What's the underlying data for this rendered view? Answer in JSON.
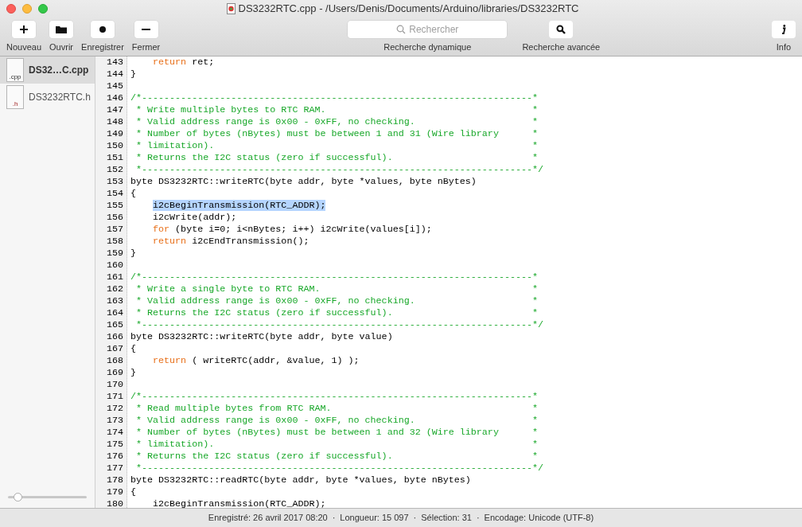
{
  "window": {
    "title": "DS3232RTC.cpp - /Users/Denis/Documents/Arduino/libraries/DS3232RTC"
  },
  "toolbar": {
    "left_buttons": [
      {
        "kind": "plus",
        "label": "Nouveau"
      },
      {
        "kind": "folder",
        "label": "Ouvrir"
      },
      {
        "kind": "dot",
        "label": "Enregistrer"
      },
      {
        "kind": "minus",
        "label": "Fermer"
      }
    ],
    "search": {
      "placeholder": "Rechercher",
      "label": "Recherche dynamique"
    },
    "advanced_search": {
      "label": "Recherche avancée"
    },
    "info": {
      "label": "Info"
    }
  },
  "sidebar": {
    "items": [
      {
        "kind": "cpp",
        "name": "DS32…C.cpp",
        "badge": ".cpp",
        "selected": true
      },
      {
        "kind": "h",
        "name": "DS3232RTC.h",
        "badge": ".h",
        "selected": false
      }
    ],
    "zoom_slider": {
      "level": 0.08
    }
  },
  "editor": {
    "lines": [
      {
        "number": "143",
        "indent": true,
        "segments": [
          {
            "kind": "keyword",
            "text": "return"
          },
          {
            "kind": "code",
            "text": " ret;"
          }
        ]
      },
      {
        "number": "144",
        "segments": [
          {
            "kind": "code",
            "text": "}"
          }
        ]
      },
      {
        "number": "145"
      },
      {
        "number": "146",
        "segments": [
          {
            "kind": "comment",
            "text": "/*----------------------------------------------------------------------"
          },
          {
            "kind": "star",
            "text": "*"
          }
        ]
      },
      {
        "number": "147",
        "segments": [
          {
            "kind": "comment",
            "text": " * Write multiple bytes to RTC RAM."
          },
          {
            "kind": "star",
            "text": "*"
          }
        ]
      },
      {
        "number": "148",
        "segments": [
          {
            "kind": "comment",
            "text": " * Valid address range is 0x00 - 0xFF, no checking."
          },
          {
            "kind": "star",
            "text": "*"
          }
        ]
      },
      {
        "number": "149",
        "segments": [
          {
            "kind": "comment",
            "text": " * Number of bytes (nBytes) must be between 1 and 31 (Wire library"
          },
          {
            "kind": "star",
            "text": "*"
          }
        ]
      },
      {
        "number": "150",
        "segments": [
          {
            "kind": "comment",
            "text": " * limitation)."
          },
          {
            "kind": "star",
            "text": "*"
          }
        ]
      },
      {
        "number": "151",
        "segments": [
          {
            "kind": "comment",
            "text": " * Returns the I2C status (zero if successful)."
          },
          {
            "kind": "star",
            "text": "*"
          }
        ]
      },
      {
        "number": "152",
        "segments": [
          {
            "kind": "comment",
            "text": " *----------------------------------------------------------------------*/"
          }
        ]
      },
      {
        "number": "153",
        "segments": [
          {
            "kind": "code",
            "text": "byte DS3232RTC::writeRTC(byte addr, byte *values, byte nBytes)"
          }
        ]
      },
      {
        "number": "154",
        "segments": [
          {
            "kind": "code",
            "text": "{"
          }
        ]
      },
      {
        "number": "155",
        "indent": true,
        "segments": [
          {
            "kind": "selected",
            "text": "i2cBeginTransmission(RTC_ADDR);"
          }
        ]
      },
      {
        "number": "156",
        "segments": [
          {
            "kind": "code",
            "text": "    i2cWrite(addr);"
          }
        ]
      },
      {
        "number": "157",
        "indent": true,
        "segments": [
          {
            "kind": "keyword",
            "text": "for"
          },
          {
            "kind": "code",
            "text": " (byte i=0; i<nBytes; i++) i2cWrite(values[i]);"
          }
        ]
      },
      {
        "number": "158",
        "indent": true,
        "segments": [
          {
            "kind": "keyword",
            "text": "return"
          },
          {
            "kind": "code",
            "text": " i2cEndTransmission();"
          }
        ]
      },
      {
        "number": "159",
        "segments": [
          {
            "kind": "code",
            "text": "}"
          }
        ]
      },
      {
        "number": "160"
      },
      {
        "number": "161",
        "segments": [
          {
            "kind": "comment",
            "text": "/*----------------------------------------------------------------------"
          },
          {
            "kind": "star",
            "text": "*"
          }
        ]
      },
      {
        "number": "162",
        "segments": [
          {
            "kind": "comment",
            "text": " * Write a single byte to RTC RAM."
          },
          {
            "kind": "star",
            "text": "*"
          }
        ]
      },
      {
        "number": "163",
        "segments": [
          {
            "kind": "comment",
            "text": " * Valid address range is 0x00 - 0xFF, no checking."
          },
          {
            "kind": "star",
            "text": "*"
          }
        ]
      },
      {
        "number": "164",
        "segments": [
          {
            "kind": "comment",
            "text": " * Returns the I2C status (zero if successful)."
          },
          {
            "kind": "star",
            "text": "*"
          }
        ]
      },
      {
        "number": "165",
        "segments": [
          {
            "kind": "comment",
            "text": " *----------------------------------------------------------------------*/"
          }
        ]
      },
      {
        "number": "166",
        "segments": [
          {
            "kind": "code",
            "text": "byte DS3232RTC::writeRTC(byte addr, byte value)"
          }
        ]
      },
      {
        "number": "167",
        "segments": [
          {
            "kind": "code",
            "text": "{"
          }
        ]
      },
      {
        "number": "168",
        "indent": true,
        "segments": [
          {
            "kind": "keyword",
            "text": "return"
          },
          {
            "kind": "code",
            "text": " ( writeRTC(addr, &value, 1) );"
          }
        ]
      },
      {
        "number": "169",
        "segments": [
          {
            "kind": "code",
            "text": "}"
          }
        ]
      },
      {
        "number": "170"
      },
      {
        "number": "171",
        "segments": [
          {
            "kind": "comment",
            "text": "/*----------------------------------------------------------------------"
          },
          {
            "kind": "star",
            "text": "*"
          }
        ]
      },
      {
        "number": "172",
        "segments": [
          {
            "kind": "comment",
            "text": " * Read multiple bytes from RTC RAM."
          },
          {
            "kind": "star",
            "text": "*"
          }
        ]
      },
      {
        "number": "173",
        "segments": [
          {
            "kind": "comment",
            "text": " * Valid address range is 0x00 - 0xFF, no checking."
          },
          {
            "kind": "star",
            "text": "*"
          }
        ]
      },
      {
        "number": "174",
        "segments": [
          {
            "kind": "comment",
            "text": " * Number of bytes (nBytes) must be between 1 and 32 (Wire library"
          },
          {
            "kind": "star",
            "text": "*"
          }
        ]
      },
      {
        "number": "175",
        "segments": [
          {
            "kind": "comment",
            "text": " * limitation)."
          },
          {
            "kind": "star",
            "text": "*"
          }
        ]
      },
      {
        "number": "176",
        "segments": [
          {
            "kind": "comment",
            "text": " * Returns the I2C status (zero if successful)."
          },
          {
            "kind": "star",
            "text": "*"
          }
        ]
      },
      {
        "number": "177",
        "segments": [
          {
            "kind": "comment",
            "text": " *----------------------------------------------------------------------*/"
          }
        ]
      },
      {
        "number": "178",
        "segments": [
          {
            "kind": "code",
            "text": "byte DS3232RTC::readRTC(byte addr, byte *values, byte nBytes)"
          }
        ]
      },
      {
        "number": "179",
        "segments": [
          {
            "kind": "code",
            "text": "{"
          }
        ]
      },
      {
        "number": "180",
        "segments": [
          {
            "kind": "code",
            "text": "    i2cBeginTransmission(RTC_ADDR);"
          }
        ]
      }
    ]
  },
  "status_bar": {
    "items": [
      "Enregistré: 26 avril 2017 08:20",
      "Longueur: 15 097",
      "Sélection: 31",
      "Encodage: Unicode (UTF-8)"
    ],
    "separator": "·"
  }
}
